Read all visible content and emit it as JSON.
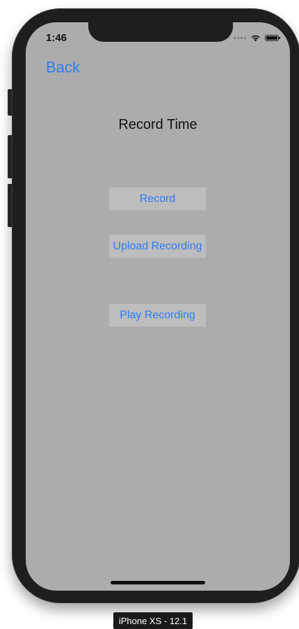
{
  "status_bar": {
    "time": "1:46"
  },
  "nav": {
    "back_label": "Back"
  },
  "main": {
    "title": "Record Time",
    "buttons": {
      "record": "Record",
      "upload": "Upload Recording",
      "play": "Play Recording"
    }
  },
  "device": {
    "label": "iPhone XS - 12.1"
  },
  "icons": {
    "wifi": "wifi-icon",
    "battery": "battery-icon",
    "signal": "signal-dots-icon"
  },
  "colors": {
    "screen_background": "#acacac",
    "button_background": "#bdbdbd",
    "accent": "#2f7bf5",
    "bezel": "#1e1e1e"
  }
}
